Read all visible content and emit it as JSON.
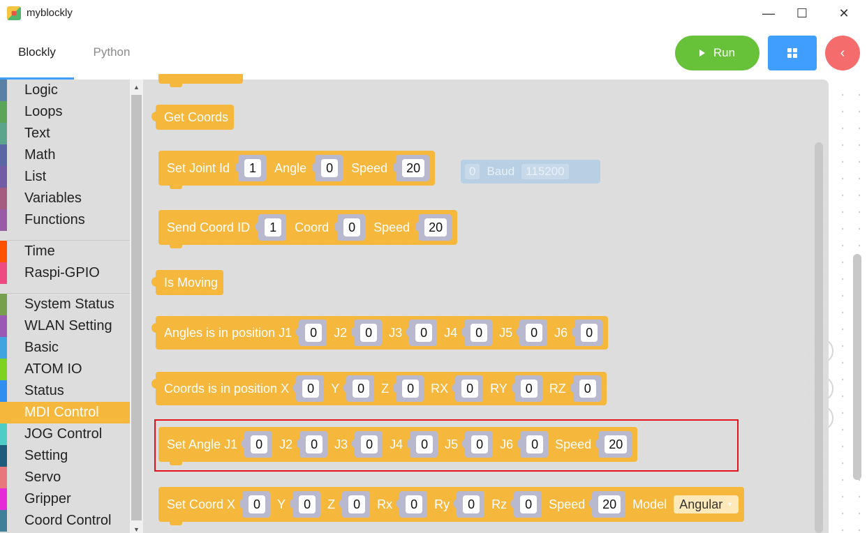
{
  "window": {
    "title": "myblockly",
    "minimize_glyph": "—",
    "maximize_glyph": "☐",
    "close_glyph": "✕"
  },
  "tabs": [
    {
      "label": "Blockly",
      "active": true
    },
    {
      "label": "Python",
      "active": false
    }
  ],
  "toolbar": {
    "run_label": "Run",
    "back_glyph": "‹"
  },
  "colors": {
    "block": "#f5b73c",
    "run": "#67c23a",
    "grid_btn": "#409eff",
    "back_btn": "#f56c6c",
    "highlight_border": "#e6121b"
  },
  "toolbox": {
    "groups": [
      [
        {
          "label": "Logic",
          "color": "#5b80a5"
        },
        {
          "label": "Loops",
          "color": "#5ba55b"
        },
        {
          "label": "Text",
          "color": "#5ba58c"
        },
        {
          "label": "Math",
          "color": "#5b67a5"
        },
        {
          "label": "List",
          "color": "#745ba5"
        },
        {
          "label": "Variables",
          "color": "#a55b80"
        },
        {
          "label": "Functions",
          "color": "#995ba5"
        }
      ],
      [
        {
          "label": "Time",
          "color": "#ff4f00"
        },
        {
          "label": "Raspi-GPIO",
          "color": "#ee4b82"
        }
      ],
      [
        {
          "label": "System Status",
          "color": "#76a04b"
        },
        {
          "label": "WLAN Setting",
          "color": "#9b59b6"
        },
        {
          "label": "Basic",
          "color": "#3fa4e0"
        },
        {
          "label": "ATOM IO",
          "color": "#7ed321"
        },
        {
          "label": "Status",
          "color": "#2f8ef0"
        },
        {
          "label": "MDI Control",
          "color": "#f5b73c",
          "selected": true
        },
        {
          "label": "JOG Control",
          "color": "#4ecdc4"
        },
        {
          "label": "Setting",
          "color": "#1f5b7a"
        },
        {
          "label": "Servo",
          "color": "#e8777c"
        },
        {
          "label": "Gripper",
          "color": "#e62ad8"
        },
        {
          "label": "Coord Control",
          "color": "#3f7f99"
        }
      ]
    ]
  },
  "background_block": {
    "value": "0",
    "baud_label": "Baud",
    "baud_value": "115200"
  },
  "blocks": {
    "get_coords": {
      "label": "Get Coords"
    },
    "set_joint_id": {
      "label": "Set Joint Id",
      "id": "1",
      "angle_label": "Angle",
      "angle": "0",
      "speed_label": "Speed",
      "speed": "20"
    },
    "send_coord_id": {
      "label": "Send Coord ID",
      "id": "1",
      "coord_label": "Coord",
      "coord": "0",
      "speed_label": "Speed",
      "speed": "20"
    },
    "is_moving": {
      "label": "Is Moving"
    },
    "angles_in_position": {
      "label": "Angles is in position J1",
      "j1": "0",
      "j2_label": "J2",
      "j2": "0",
      "j3_label": "J3",
      "j3": "0",
      "j4_label": "J4",
      "j4": "0",
      "j5_label": "J5",
      "j5": "0",
      "j6_label": "J6",
      "j6": "0"
    },
    "coords_in_position": {
      "label": "Coords is in position X",
      "x": "0",
      "y_label": "Y",
      "y": "0",
      "z_label": "Z",
      "z": "0",
      "rx_label": "RX",
      "rx": "0",
      "ry_label": "RY",
      "ry": "0",
      "rz_label": "RZ",
      "rz": "0"
    },
    "set_angle": {
      "label": "Set Angle J1",
      "j1": "0",
      "j2_label": "J2",
      "j2": "0",
      "j3_label": "J3",
      "j3": "0",
      "j4_label": "J4",
      "j4": "0",
      "j5_label": "J5",
      "j5": "0",
      "j6_label": "J6",
      "j6": "0",
      "speed_label": "Speed",
      "speed": "20"
    },
    "set_coord": {
      "label": "Set Coord X",
      "x": "0",
      "y_label": "Y",
      "y": "0",
      "z_label": "Z",
      "z": "0",
      "rx_label": "Rx",
      "rx": "0",
      "ry_label": "Ry",
      "ry": "0",
      "rz_label": "Rz",
      "rz": "0",
      "speed_label": "Speed",
      "speed": "20",
      "model_label": "Model",
      "model": "Angular"
    }
  }
}
